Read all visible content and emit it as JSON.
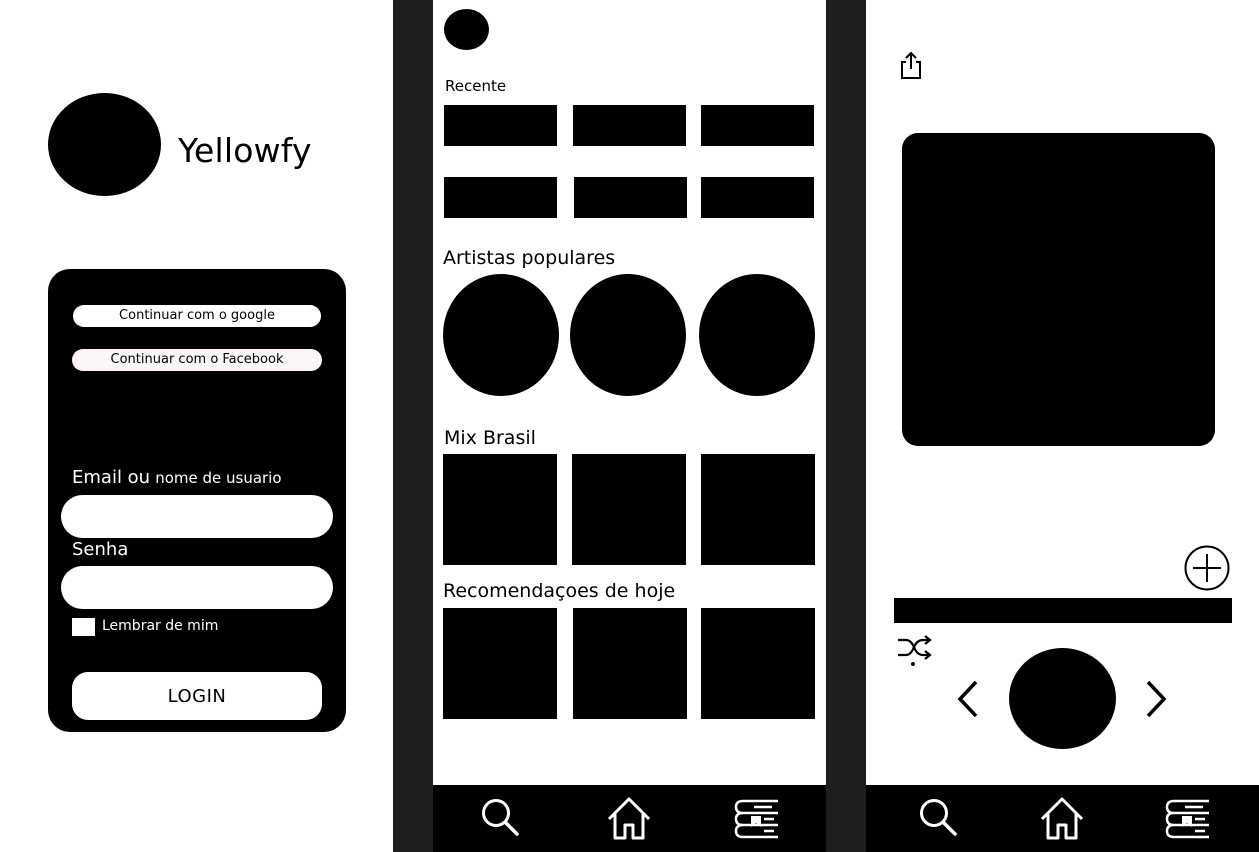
{
  "login": {
    "app_name": "Yellowfy",
    "google_button": "Continuar com o google",
    "facebook_button": "Continuar com o Facebook",
    "email_label_main": "Email ou",
    "email_label_small": "nome de usuario",
    "email_value": "",
    "password_label": "Senha",
    "password_value": "",
    "remember_label": "Lembrar de mim",
    "remember_checked": false,
    "login_button": "LOGIN"
  },
  "home": {
    "recent_title": "Recente",
    "artists_title": "Artistas populares",
    "mix_title": "Mix Brasil",
    "recommendations_title": "Recomendaçoes de hoje"
  },
  "navbar": {
    "items": [
      {
        "icon": "search-icon"
      },
      {
        "icon": "home-icon"
      },
      {
        "icon": "library-icon"
      }
    ]
  },
  "player": {
    "icons": [
      "share-icon",
      "add-icon",
      "shuffle-icon",
      "previous-icon",
      "play-button",
      "next-icon"
    ]
  },
  "colors": {
    "background": "#ffffff",
    "foreground": "#000000",
    "gutter": "#1e1e1e"
  }
}
